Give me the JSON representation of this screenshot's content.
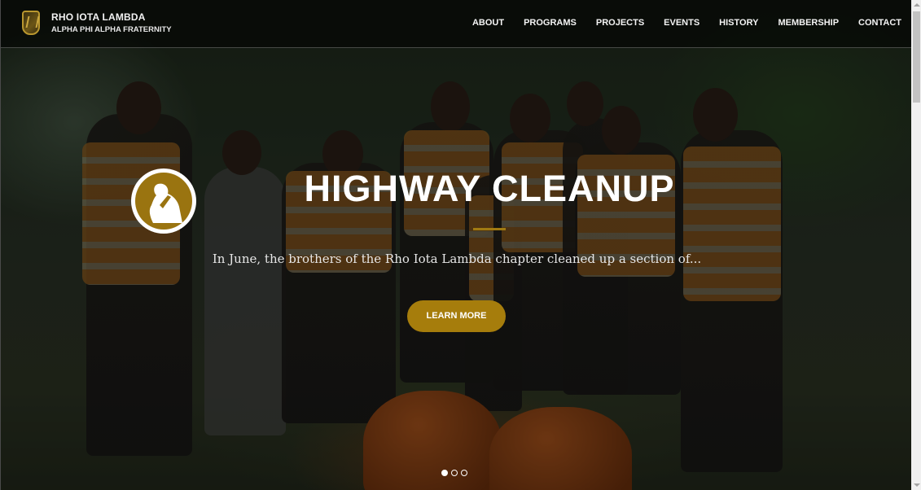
{
  "brand": {
    "title": "RHO IOTA LAMBDA",
    "subtitle": "ALPHA PHI ALPHA FRATERNITY",
    "logo_icon": "fraternity-crest-icon"
  },
  "nav": {
    "items": [
      "ABOUT",
      "PROGRAMS",
      "PROJECTS",
      "EVENTS",
      "HISTORY",
      "MEMBERSHIP",
      "CONTACT"
    ]
  },
  "hero": {
    "badge_icon": "praying-hands-icon",
    "title": "HIGHWAY CLEANUP",
    "description": "In June, the brothers of the Rho Iota Lambda chapter cleaned up a section of...",
    "cta_label": "LEARN MORE",
    "slides_total": 3,
    "active_slide": 1
  },
  "colors": {
    "accent_gold": "#a67d0c",
    "text_white": "#ffffff"
  }
}
